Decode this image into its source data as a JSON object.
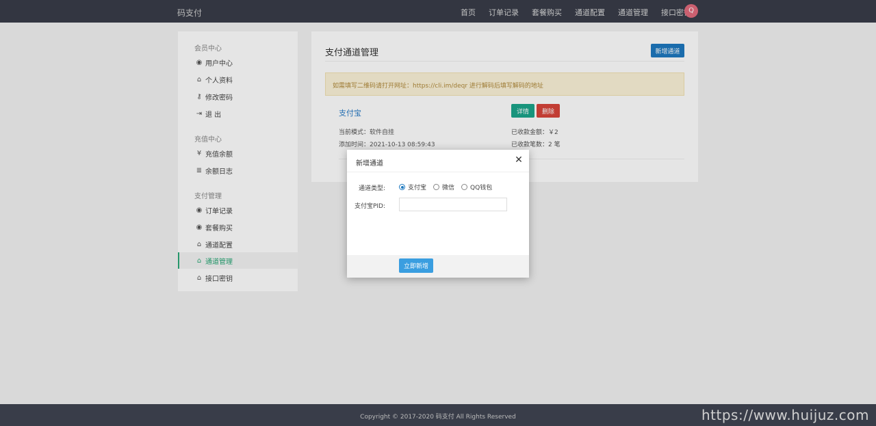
{
  "topbar": {
    "brand": "码支付",
    "nav": [
      "首页",
      "订单记录",
      "套餐购买",
      "通道配置",
      "通道管理",
      "接口密钥"
    ],
    "avatar_letter": "Q"
  },
  "sidebar": {
    "groups": [
      {
        "title": "会员中心",
        "items": [
          {
            "icon": "user-circle-icon",
            "glyph": "◉",
            "label": "用户中心"
          },
          {
            "icon": "lock-icon",
            "glyph": "🔓",
            "label": "个人资料"
          },
          {
            "icon": "key-icon",
            "glyph": "⚷",
            "label": "修改密码"
          },
          {
            "icon": "logout-icon",
            "glyph": "⇥",
            "label": "退 出"
          }
        ]
      },
      {
        "title": "充值中心",
        "items": [
          {
            "icon": "yen-icon",
            "glyph": "¥",
            "label": "充值余额"
          },
          {
            "icon": "list-icon",
            "glyph": "≣",
            "label": "余额日志"
          }
        ]
      },
      {
        "title": "支付管理",
        "items": [
          {
            "icon": "user-circle-icon",
            "glyph": "◉",
            "label": "订单记录"
          },
          {
            "icon": "user-circle-icon",
            "glyph": "◉",
            "label": "套餐购买"
          },
          {
            "icon": "lock-icon",
            "glyph": "🔓",
            "label": "通道配置"
          },
          {
            "icon": "lock-icon",
            "glyph": "🔓",
            "label": "通道管理",
            "active": true
          },
          {
            "icon": "lock-icon",
            "glyph": "🔓",
            "label": "接口密钥"
          }
        ]
      }
    ]
  },
  "main": {
    "title": "支付通道管理",
    "new_button": "新增通道",
    "notice": "如需填写二维码请打开网址：https://cli.im/deqr 进行解码后填写解码的地址",
    "channel": {
      "name": "支付宝",
      "detail_button": "详情",
      "delete_button": "删除",
      "mode": "当前模式：软件自挂",
      "added": "添加时间：2021-10-13 08:59:43",
      "amount": "已收款金额：￥2",
      "count": "已收款笔数：2 笔"
    }
  },
  "modal": {
    "title": "新增通道",
    "close_glyph": "✕",
    "type_label": "通道类型:",
    "options": [
      "支付宝",
      "微信",
      "QQ钱包"
    ],
    "selected": "支付宝",
    "pid_label": "支付宝PID:",
    "pid_value": "",
    "submit": "立即新增"
  },
  "footer": {
    "copyright": "Copyright © 2017-2020 码支付 All Rights Reserved",
    "watermark": "https://www.huijuz.com"
  },
  "colors": {
    "topbar": "#393d49",
    "accent_blue": "#1e79c0",
    "accent_green": "#1ba58b",
    "danger": "#d9443a",
    "active_side": "#2aa876"
  }
}
